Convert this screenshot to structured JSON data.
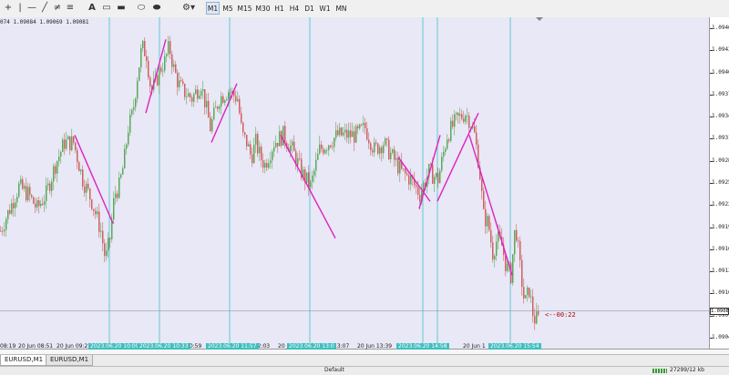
{
  "toolbar": {
    "icons": [
      "crosshair-icon",
      "vertical-line-icon",
      "horizontal-line-icon",
      "trendline-icon",
      "channel-icon",
      "fibonacci-icon",
      "text-icon",
      "label-icon",
      "rectangle-icon",
      "ellipse-icon",
      "arrow-icon",
      "more-tools-icon"
    ],
    "timeframes": [
      "M1",
      "M5",
      "M15",
      "M30",
      "H1",
      "H4",
      "D1",
      "W1",
      "MN"
    ],
    "active_timeframe": "M1"
  },
  "chart": {
    "ohlc_readout": "074 1.09084 1.09069 1.09081",
    "countdown": "<--00:22",
    "current_price": "1.09081",
    "price_labels": [
      "1.09465",
      "1.09435",
      "1.09405",
      "1.09375",
      "1.09345",
      "1.09315",
      "1.09285",
      "1.09255",
      "1.09225",
      "1.09195",
      "1.09165",
      "1.09135",
      "1.09105",
      "1.09075",
      "1.09045"
    ],
    "time_labels": [
      {
        "text": "08:19"
      },
      {
        "text": "20 Jun 08:51"
      },
      {
        "text": "20 Jun 09:2"
      },
      {
        "text": "10:59"
      },
      {
        "text": "20 Jun 12:03"
      },
      {
        "text": "20 Jun 1"
      },
      {
        "text": "13:07"
      },
      {
        "text": "20 Jun 13:39"
      },
      {
        "text": "20 Jun 1"
      },
      {
        "text": "20 Jun 15"
      }
    ],
    "vline_tags": [
      "2023.06.20 10:09",
      "2023.06.20 10:33",
      "2023.06.20 11:57",
      "2023.06.20 13:0",
      "2023.06.20 14:58",
      "2023.06.20 15:54"
    ]
  },
  "tabs": [
    {
      "label": "EURUSD,M1",
      "active": true
    },
    {
      "label": "EURUSD,M1",
      "active": false
    }
  ],
  "status": {
    "profile": "Default",
    "traffic": "27299/12 kb"
  },
  "chart_data": {
    "type": "candlestick",
    "symbol": "EURUSD",
    "timeframe": "M1",
    "ylim": [
      1.0903,
      1.0948
    ],
    "y_ticks": [
      1.09465,
      1.09435,
      1.09405,
      1.09375,
      1.09345,
      1.09315,
      1.09285,
      1.09255,
      1.09225,
      1.09195,
      1.09165,
      1.09135,
      1.09105,
      1.09075,
      1.09045
    ],
    "current_price": 1.09081,
    "up_color": "#5aa85a",
    "down_color": "#d06060",
    "bg_color": "#e8e8f6",
    "trendline_color": "#e020c0",
    "vline_color": "#40c0d0",
    "price_path": [
      [
        0,
        1.0919
      ],
      [
        10,
        1.0922
      ],
      [
        20,
        1.0925
      ],
      [
        30,
        1.0924
      ],
      [
        40,
        1.0922
      ],
      [
        50,
        1.0924
      ],
      [
        60,
        1.0928
      ],
      [
        70,
        1.0931
      ],
      [
        80,
        1.0931
      ],
      [
        90,
        1.0926
      ],
      [
        100,
        1.0923
      ],
      [
        110,
        1.0919
      ],
      [
        115,
        1.0915
      ],
      [
        120,
        1.0918
      ],
      [
        125,
        1.0924
      ],
      [
        130,
        1.0925
      ],
      [
        135,
        1.0928
      ],
      [
        140,
        1.0933
      ],
      [
        145,
        1.0935
      ],
      [
        150,
        1.094
      ],
      [
        155,
        1.0944
      ],
      [
        160,
        1.0943
      ],
      [
        165,
        1.0938
      ],
      [
        170,
        1.0939
      ],
      [
        175,
        1.0941
      ],
      [
        180,
        1.0942
      ],
      [
        185,
        1.0944
      ],
      [
        190,
        1.0941
      ],
      [
        195,
        1.0939
      ],
      [
        200,
        1.0938
      ],
      [
        210,
        1.0937
      ],
      [
        220,
        1.0939
      ],
      [
        230,
        1.0933
      ],
      [
        240,
        1.0937
      ],
      [
        250,
        1.0938
      ],
      [
        260,
        1.0937
      ],
      [
        265,
        1.0932
      ],
      [
        270,
        1.0931
      ],
      [
        275,
        1.0929
      ],
      [
        280,
        1.0931
      ],
      [
        285,
        1.0929
      ],
      [
        290,
        1.0928
      ],
      [
        300,
        1.0931
      ],
      [
        310,
        1.0932
      ],
      [
        320,
        1.093
      ],
      [
        330,
        1.0927
      ],
      [
        340,
        1.0925
      ],
      [
        350,
        1.093
      ],
      [
        360,
        1.0931
      ],
      [
        370,
        1.0932
      ],
      [
        380,
        1.0932
      ],
      [
        390,
        1.0932
      ],
      [
        400,
        1.0933
      ],
      [
        410,
        1.093
      ],
      [
        420,
        1.0931
      ],
      [
        430,
        1.0929
      ],
      [
        440,
        1.0927
      ],
      [
        450,
        1.0926
      ],
      [
        460,
        1.0924
      ],
      [
        470,
        1.0927
      ],
      [
        480,
        1.0926
      ],
      [
        490,
        1.0932
      ],
      [
        500,
        1.0934
      ],
      [
        510,
        1.0935
      ],
      [
        515,
        1.0934
      ],
      [
        520,
        1.0932
      ],
      [
        525,
        1.0928
      ],
      [
        530,
        1.0921
      ],
      [
        535,
        1.092
      ],
      [
        540,
        1.0916
      ],
      [
        545,
        1.0918
      ],
      [
        550,
        1.0917
      ],
      [
        555,
        1.0914
      ],
      [
        560,
        1.0913
      ],
      [
        565,
        1.092
      ],
      [
        570,
        1.0914
      ],
      [
        575,
        1.0909
      ],
      [
        580,
        1.0911
      ],
      [
        585,
        1.0907
      ],
      [
        590,
        1.0907
      ]
    ],
    "trendlines": [
      {
        "x": [
          82,
          124
        ],
        "y": [
          1.0932,
          1.092
        ]
      },
      {
        "x": [
          160,
          182
        ],
        "y": [
          1.0935,
          1.0945
        ]
      },
      {
        "x": [
          232,
          260
        ],
        "y": [
          1.0931,
          1.0939
        ]
      },
      {
        "x": [
          308,
          368
        ],
        "y": [
          1.0932,
          1.0918
        ]
      },
      {
        "x": [
          437,
          472
        ],
        "y": [
          1.0929,
          1.0923
        ]
      },
      {
        "x": [
          460,
          483
        ],
        "y": [
          1.0922,
          1.0932
        ]
      },
      {
        "x": [
          480,
          525
        ],
        "y": [
          1.0923,
          1.0935
        ]
      },
      {
        "x": [
          515,
          562
        ],
        "y": [
          1.0932,
          1.0913
        ]
      }
    ],
    "vertical_lines_x": [
      120,
      175,
      252,
      340,
      464,
      480,
      560
    ],
    "grid": false
  }
}
